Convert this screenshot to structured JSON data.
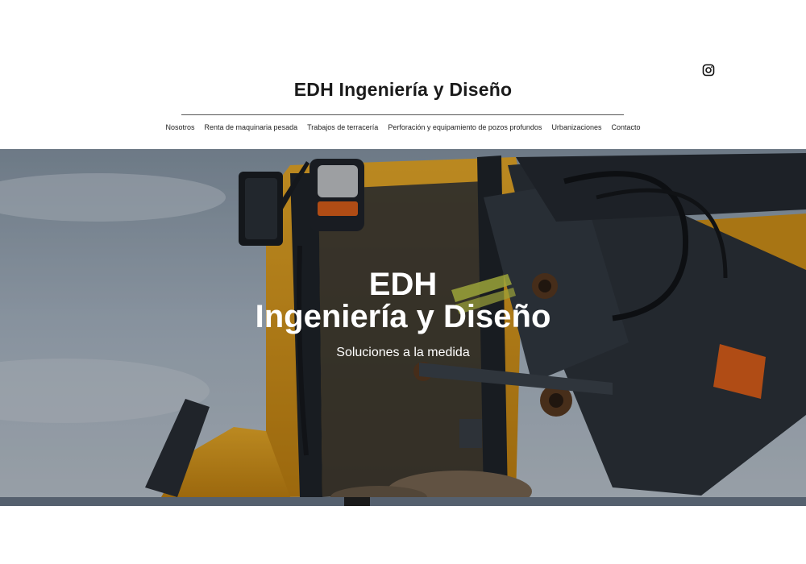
{
  "header": {
    "site_title": "EDH Ingeniería y Diseño",
    "social_icon": "instagram-icon"
  },
  "nav": {
    "items": [
      {
        "label": "Nosotros"
      },
      {
        "label": "Renta de maquinaria pesada"
      },
      {
        "label": "Trabajos de terracería"
      },
      {
        "label": "Perforación y equipamiento de pozos profundos"
      },
      {
        "label": "Urbanizaciones"
      },
      {
        "label": "Contacto"
      }
    ]
  },
  "hero": {
    "title_line1": "EDH",
    "title_line2": "Ingeniería y Diseño",
    "subtitle": "Soluciones a la medida"
  },
  "colors": {
    "text": "#1a1a1a",
    "machine_yellow": "#e9a21a",
    "machine_dark": "#2e343c",
    "indicator_orange": "#e2621c",
    "sky": "#a9b9c8"
  }
}
